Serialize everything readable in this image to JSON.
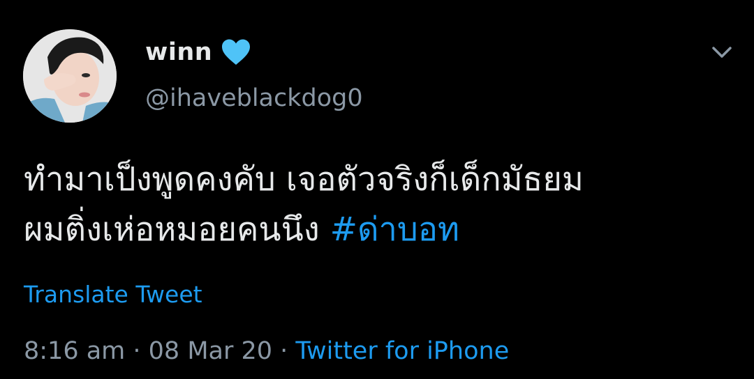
{
  "author": {
    "display_name": "winn",
    "handle": "@ihaveblackdog0",
    "badge_icon": "blue-heart-icon"
  },
  "tweet": {
    "text_line_1": "ทำมาเป็งพูดคงคับ เจอตัวจริงก็เด็กมัธยม",
    "text_line_2": "ผมติ่งเห่อหมอยคนนึง",
    "hashtag": "#ด่าบอท",
    "translate_label": "Translate Tweet"
  },
  "meta": {
    "time": "8:16 am",
    "separator_1": " · ",
    "date": "08 Mar 20",
    "separator_2": " · ",
    "source": "Twitter for iPhone"
  },
  "menu": {
    "icon": "chevron-down-icon"
  },
  "colors": {
    "background": "#000000",
    "text": "#e7e9ea",
    "secondary": "#8b98a5",
    "accent": "#1d9bf0",
    "heart": "#4fc3f7"
  }
}
